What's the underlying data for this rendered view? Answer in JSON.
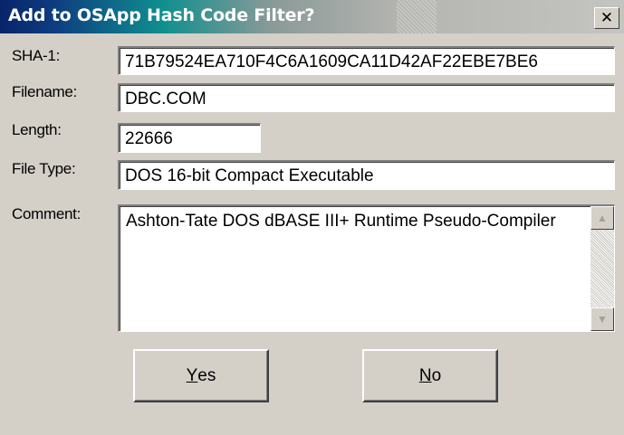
{
  "window": {
    "title": "Add to OSApp Hash Code Filter?",
    "close_glyph": "✕"
  },
  "fields": {
    "sha1_label": "SHA-1:",
    "sha1_value": "71B79524EA710F4C6A1609CA11D42AF22EBE7BE6",
    "filename_label": "Filename:",
    "filename_value": "DBC.COM",
    "length_label": "Length:",
    "length_value": "22666",
    "filetype_label": "File Type:",
    "filetype_value": "DOS 16-bit Compact Executable",
    "comment_label": "Comment:",
    "comment_value": "Ashton-Tate DOS dBASE III+ Runtime Pseudo-Compiler"
  },
  "buttons": {
    "yes_mnemonic": "Y",
    "yes_rest": "es",
    "no_mnemonic": "N",
    "no_rest": "o"
  }
}
